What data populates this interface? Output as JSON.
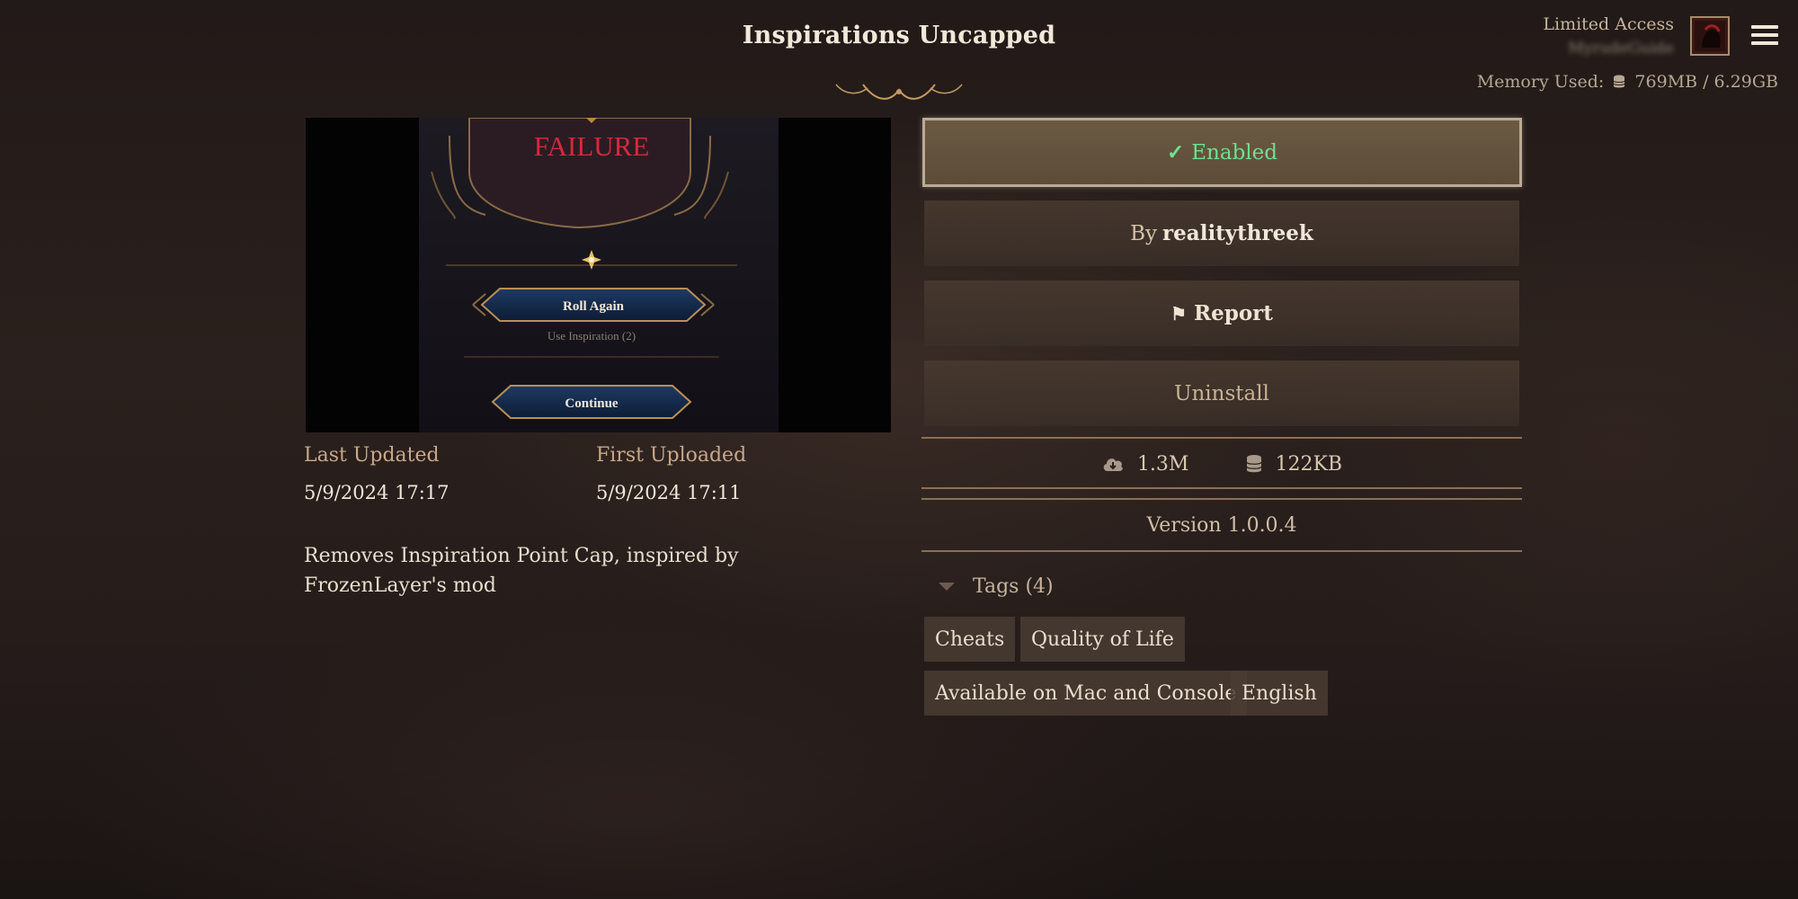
{
  "header": {
    "title": "Inspirations Uncapped",
    "account_status": "Limited Access",
    "username": "MyrudeGuide",
    "memory_label": "Memory Used:",
    "memory_value": "769MB / 6.29GB"
  },
  "preview": {
    "failure_text": "FAILURE",
    "roll_again_label": "Roll Again",
    "use_inspiration_text": "Use Inspiration (2)",
    "continue_label": "Continue"
  },
  "details": {
    "last_updated_label": "Last Updated",
    "last_updated_value": "5/9/2024 17:17",
    "first_uploaded_label": "First Uploaded",
    "first_uploaded_value": "5/9/2024 17:11",
    "description": "Removes Inspiration Point Cap, inspired by FrozenLayer's mod"
  },
  "actions": {
    "enabled_label": "Enabled",
    "by_label": "By",
    "author": "realitythreek",
    "report_label": "Report",
    "uninstall_label": "Uninstall"
  },
  "stats": {
    "downloads": "1.3M",
    "size": "122KB",
    "version": "Version 1.0.0.4"
  },
  "tags": {
    "header": "Tags (4)",
    "items": [
      "Cheats",
      "Quality of Life",
      "Available on Mac and Console",
      "English"
    ]
  },
  "colors": {
    "enabled_green": "#6fe08f",
    "failure_red": "#d42a3a",
    "divider_brown": "#8c6f56"
  }
}
